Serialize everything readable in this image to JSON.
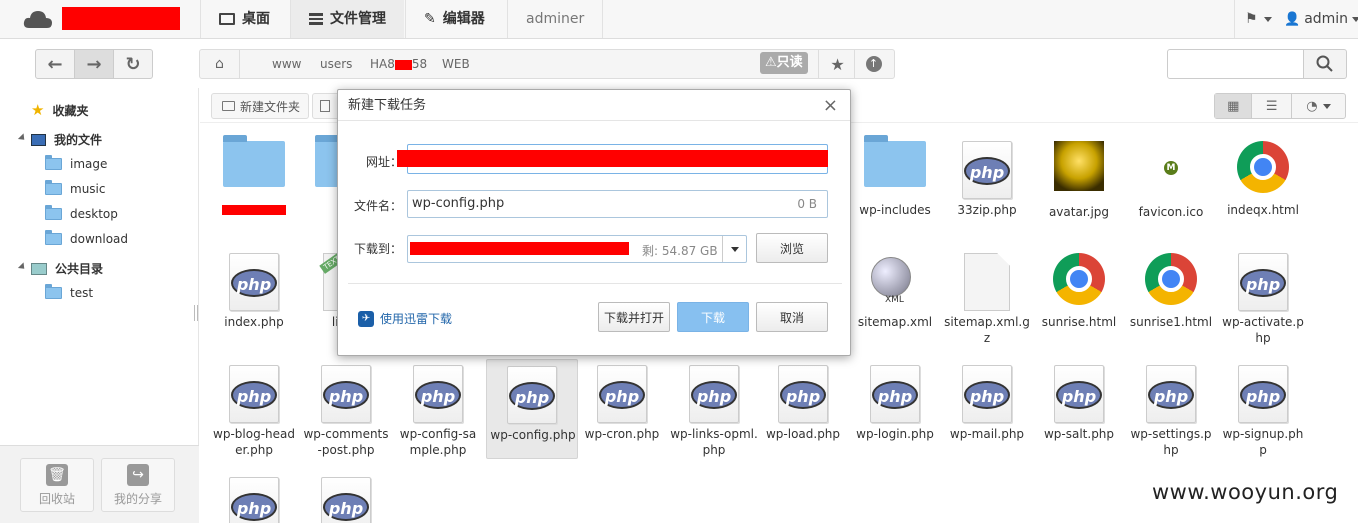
{
  "app": {
    "brand_redacted": true
  },
  "nav": {
    "desktop": "桌面",
    "file_manager": "文件管理",
    "editor": "编辑器",
    "adminer": "adminer",
    "user": "admin"
  },
  "breadcrumb": [
    "www",
    "users",
    "HA8",
    "58",
    "WEB"
  ],
  "readonly": "只读",
  "sidebar": {
    "favorites": "收藏夹",
    "my_files": "我的文件",
    "my_files_children": [
      "image",
      "music",
      "desktop",
      "download"
    ],
    "public": "公共目录",
    "public_children": [
      "test"
    ],
    "recycle": "回收站",
    "share": "我的分享"
  },
  "toolbar": {
    "new_folder": "新建文件夹"
  },
  "files": [
    {
      "name": "",
      "type": "folder",
      "redacted": true
    },
    {
      "name": "",
      "type": "folder"
    },
    {
      "name": "wp-includes",
      "type": "folder"
    },
    {
      "name": "33zip.php",
      "type": "php"
    },
    {
      "name": "avatar.jpg",
      "type": "image"
    },
    {
      "name": "favicon.ico",
      "type": "ico"
    },
    {
      "name": "indeqx.html",
      "type": "chrome"
    },
    {
      "name": "index.php",
      "type": "php"
    },
    {
      "name": "licen",
      "type": "text"
    },
    {
      "name": "sitemap.xml",
      "type": "xml"
    },
    {
      "name": "sitemap.xml.gz",
      "type": "plain"
    },
    {
      "name": "sunrise.html",
      "type": "chrome"
    },
    {
      "name": "sunrise1.html",
      "type": "chrome"
    },
    {
      "name": "wp-activate.php",
      "type": "php"
    },
    {
      "name": "wp-blog-header.php",
      "type": "php"
    },
    {
      "name": "wp-comments-post.php",
      "type": "php"
    },
    {
      "name": "wp-config-sample.php",
      "type": "php"
    },
    {
      "name": "wp-config.php",
      "type": "php",
      "selected": true
    },
    {
      "name": "wp-cron.php",
      "type": "php"
    },
    {
      "name": "wp-links-opml.php",
      "type": "php"
    },
    {
      "name": "wp-load.php",
      "type": "php"
    },
    {
      "name": "wp-login.php",
      "type": "php"
    },
    {
      "name": "wp-mail.php",
      "type": "php"
    },
    {
      "name": "wp-salt.php",
      "type": "php"
    },
    {
      "name": "wp-settings.php",
      "type": "php"
    },
    {
      "name": "wp-signup.php",
      "type": "php"
    },
    {
      "name": "",
      "type": "php"
    },
    {
      "name": "",
      "type": "php"
    }
  ],
  "dialog": {
    "title": "新建下载任务",
    "url_label": "网址：",
    "filename_label": "文件名：",
    "filename_value": "wp-config.php",
    "filesize": "0 B",
    "saveto_label": "下载到：",
    "free_space": "剩: 54.87 GB",
    "browse": "浏览",
    "thunder_link": "使用迅雷下载",
    "download_open": "下载并打开",
    "download": "下载",
    "cancel": "取消"
  },
  "watermark": "www.wooyun.org",
  "colors": {
    "accent": "#87c0f0",
    "redaction": "#ff0000",
    "folder": "#8cc4ee"
  }
}
